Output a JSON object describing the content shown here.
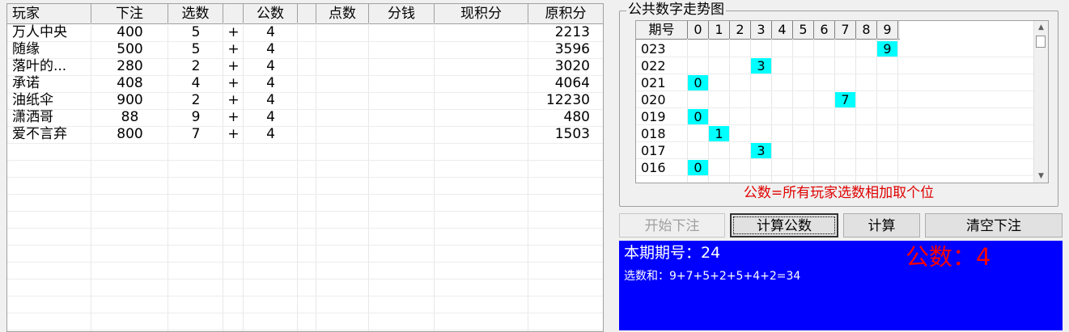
{
  "players_table": {
    "columns": [
      "玩家",
      "下注",
      "选数",
      "",
      "公数",
      "",
      "点数",
      "分钱",
      "现积分",
      "原积分"
    ],
    "rows": [
      {
        "player": "万人中央",
        "bet": "400",
        "pick": "5",
        "op": "+",
        "common": "4",
        "original_points": "2213"
      },
      {
        "player": "随缘",
        "bet": "500",
        "pick": "5",
        "op": "+",
        "common": "4",
        "original_points": "3596"
      },
      {
        "player": "落叶的...",
        "bet": "280",
        "pick": "2",
        "op": "+",
        "common": "4",
        "original_points": "3020"
      },
      {
        "player": "承诺",
        "bet": "408",
        "pick": "4",
        "op": "+",
        "common": "4",
        "original_points": "4064"
      },
      {
        "player": "油纸伞",
        "bet": "900",
        "pick": "2",
        "op": "+",
        "common": "4",
        "original_points": "12230"
      },
      {
        "player": "潇洒哥",
        "bet": "88",
        "pick": "9",
        "op": "+",
        "common": "4",
        "original_points": "480"
      },
      {
        "player": "爱不言弃",
        "bet": "800",
        "pick": "7",
        "op": "+",
        "common": "4",
        "original_points": "1503"
      }
    ]
  },
  "trend": {
    "title": "公共数字走势图",
    "header_period": "期号",
    "digits": [
      "0",
      "1",
      "2",
      "3",
      "4",
      "5",
      "6",
      "7",
      "8",
      "9"
    ],
    "rows": [
      {
        "period": "023",
        "value": 9
      },
      {
        "period": "022",
        "value": 3
      },
      {
        "period": "021",
        "value": 0
      },
      {
        "period": "020",
        "value": 7
      },
      {
        "period": "019",
        "value": 0
      },
      {
        "period": "018",
        "value": 1
      },
      {
        "period": "017",
        "value": 3
      },
      {
        "period": "016",
        "value": 0
      }
    ],
    "scroll_up_icon": "triangle-up",
    "scroll_down_icon": "triangle-down",
    "formula_text": "公数=所有玩家选数相加取个位"
  },
  "buttons": {
    "start_bet": "开始下注",
    "calc_common": "计算公数",
    "calc": "计算",
    "clear_bets": "清空下注"
  },
  "result": {
    "period_label": "本期期号：24",
    "sum_label": "选数和：9+7+5+2+5+4+2=34",
    "common_label": "公数：4"
  },
  "colors": {
    "highlight": "#00ffff",
    "panel_bg": "#0000ff",
    "accent_red": "#ff0000"
  }
}
